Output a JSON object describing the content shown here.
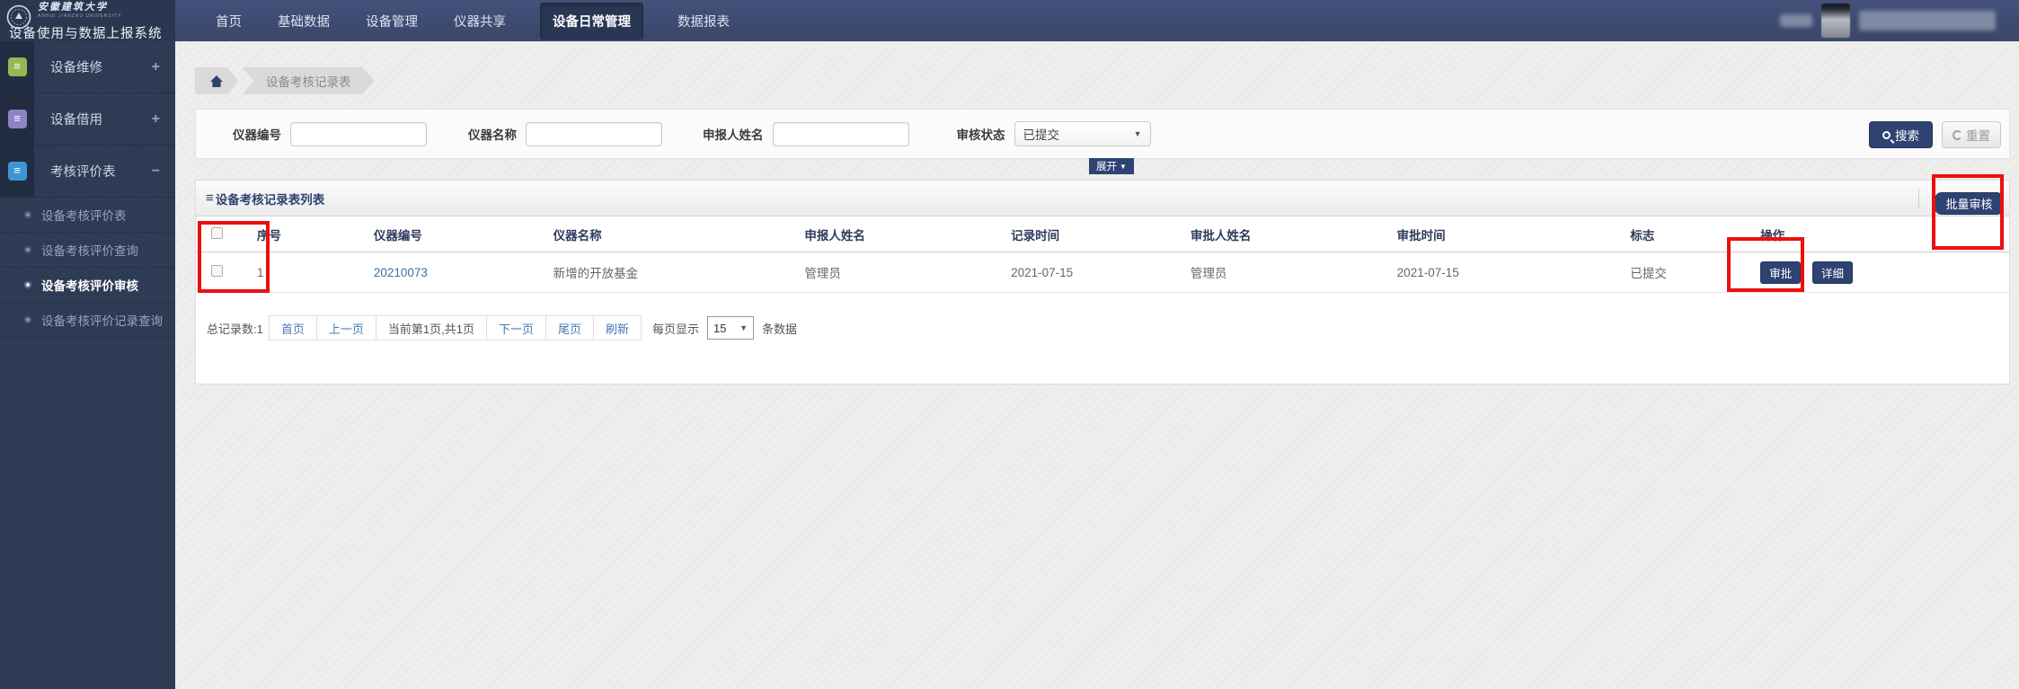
{
  "colors": {
    "accent_navy": "#2e4372",
    "topbar_navy": "#3d4b6f",
    "sidebar_navy": "#2d3a54",
    "annotation_red": "#ed0f0f",
    "link_blue": "#3f6fa8",
    "icon_green": "#94b854",
    "icon_purple": "#8f83c6",
    "icon_blue": "#3d96d2"
  },
  "icons": {
    "hamburger": "≡",
    "caret_down": "▼",
    "plus": "+",
    "minus": "−"
  },
  "topbar": {
    "university": "安徽建筑大学",
    "university_en": "ANHUI JIANZHU UNIVERSITY",
    "app_title": "设备使用与数据上报系统",
    "nav": [
      {
        "label": "首页"
      },
      {
        "label": "基础数据"
      },
      {
        "label": "设备管理"
      },
      {
        "label": "仪器共享"
      },
      {
        "label": "设备日常管理",
        "active": true
      },
      {
        "label": "数据报表"
      }
    ]
  },
  "sidebar": {
    "groups": [
      {
        "label": "设备维修",
        "toggle": "+"
      },
      {
        "label": "设备借用",
        "toggle": "+"
      },
      {
        "label": "考核评价表",
        "toggle": "−",
        "children": [
          {
            "label": "设备考核评价表"
          },
          {
            "label": "设备考核评价查询"
          },
          {
            "label": "设备考核评价审核",
            "active": true
          },
          {
            "label": "设备考核评价记录查询"
          }
        ]
      }
    ]
  },
  "breadcrumb": {
    "current": "设备考核记录表"
  },
  "search": {
    "fields": [
      {
        "label": "仪器编号",
        "value": ""
      },
      {
        "label": "仪器名称",
        "value": ""
      },
      {
        "label": "申报人姓名",
        "value": ""
      }
    ],
    "status": {
      "label": "审核状态",
      "value": "已提交"
    },
    "search_label": "搜索",
    "reset_label": "重置",
    "expand_label": "展开"
  },
  "list_panel": {
    "title": "设备考核记录表列表",
    "batch_review_label": "批量审核"
  },
  "table": {
    "headers": [
      "序号",
      "仪器编号",
      "仪器名称",
      "申报人姓名",
      "记录时间",
      "审批人姓名",
      "审批时间",
      "标志",
      "操作"
    ],
    "rows": [
      {
        "seq": "1",
        "device_code": "20210073",
        "device_name": "新增的开放基金",
        "applicant": "管理员",
        "record_time": "2021-07-15",
        "approver": "管理员",
        "approve_time": "2021-07-15",
        "status": "已提交",
        "action_review": "审批",
        "action_detail": "详细"
      }
    ]
  },
  "pagination": {
    "total": "总记录数:1",
    "first": "首页",
    "prev": "上一页",
    "current": "当前第1页,共1页",
    "next": "下一页",
    "last": "尾页",
    "refresh": "刷新",
    "per_page_prefix": "每页显示",
    "per_page_value": "15",
    "per_page_suffix": "条数据"
  }
}
